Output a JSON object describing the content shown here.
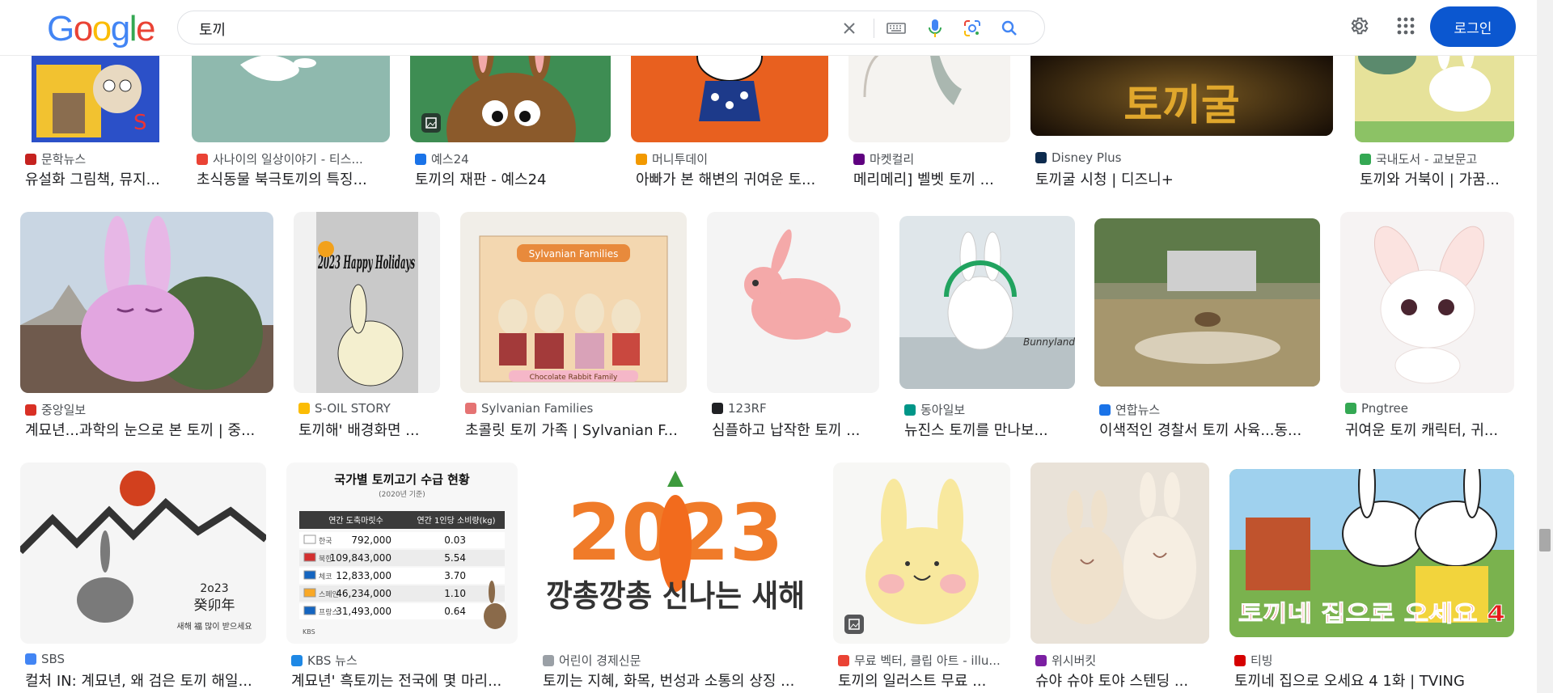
{
  "header": {
    "logo": [
      "G",
      "o",
      "o",
      "g",
      "l",
      "e"
    ],
    "logo_colors": [
      "#4285f4",
      "#ea4335",
      "#fbbc05",
      "#4285f4",
      "#34a853",
      "#ea4335"
    ],
    "query": "토끼",
    "signin": "로그인"
  },
  "results": [
    {
      "source": "문학뉴스",
      "title": "유설화 그림책, 뮤지...",
      "fav": "#c5221f"
    },
    {
      "source": "사나이의 일상이야기 - 티스...",
      "title": "초식동물 북극토끼의 특징...",
      "fav": "#ea4335"
    },
    {
      "source": "예스24",
      "title": "토끼의 재판 - 예스24",
      "fav": "#1a73e8"
    },
    {
      "source": "머니투데이",
      "title": "아빠가 본 해변의 귀여운 토...",
      "fav": "#f29900"
    },
    {
      "source": "마켓컬리",
      "title": "메리메리] 벨벳 토끼 ...",
      "fav": "#5f0080"
    },
    {
      "source": "Disney Plus",
      "title": "토끼굴 시청 | 디즈니+",
      "fav": "#0d2b4e"
    },
    {
      "source": "국내도서 - 교보문고",
      "title": "토끼와 거북이 | 가꿈...",
      "fav": "#34a853"
    },
    {
      "source": "중앙일보",
      "title": "계묘년...과학의 눈으로 본 토끼 | 중...",
      "fav": "#d93025"
    },
    {
      "source": "S-OIL STORY",
      "title": "토끼해' 배경화면 ...",
      "fav": "#fbbc05"
    },
    {
      "source": "Sylvanian Families",
      "title": "초콜릿 토끼 가족 | Sylvanian F...",
      "fav": "#e57373"
    },
    {
      "source": "123RF",
      "title": "심플하고 납작한 토끼 ...",
      "fav": "#202124"
    },
    {
      "source": "동아일보",
      "title": "뉴진스 토끼를 만나보...",
      "fav": "#009688"
    },
    {
      "source": "연합뉴스",
      "title": "이색적인 경찰서 토끼 사육...동...",
      "fav": "#1a73e8"
    },
    {
      "source": "Pngtree",
      "title": "귀여운 토끼 캐릭터, 귀...",
      "fav": "#34a853"
    },
    {
      "source": "SBS",
      "title": "컬처 IN: 계묘년, 왜 검은 토끼 해일...",
      "fav": "#4285f4"
    },
    {
      "source": "KBS 뉴스",
      "title": "계묘년' 흑토끼는 전국에 몇 마리...",
      "fav": "#1e88e5"
    },
    {
      "source": "어린이 경제신문",
      "title": "토끼는 지혜, 화목, 번성과 소통의 상징 ...",
      "fav": "#9aa0a6"
    },
    {
      "source": "무료 벡터, 클립 아트 - illu...",
      "title": "토끼의 일러스트 무료 ...",
      "fav": "#ea4335"
    },
    {
      "source": "위시버킷",
      "title": "슈야 슈야 토야 스텐딩 ...",
      "fav": "#7b1fa2"
    },
    {
      "source": "티빙",
      "title": "토끼네 집으로 오세요 4 1화 | TVING",
      "fav": "#d50000"
    }
  ],
  "images": {
    "disney_text": "토끼굴",
    "holiday_text": "2023 Happy Holidays",
    "sylvanian_brand": "Sylvanian Families",
    "sylvanian_box": "Chocolate Rabbit Family",
    "bunnyland": "Bunnyland",
    "sbs_year": "2o23",
    "sbs_cjk": "癸卯年",
    "sbs_small": "새해 福 많이 받으세요",
    "kbs_title": "국가별 토끼고기 수급 현황",
    "kbs_sub": "(2020년 기준)",
    "kbs_table_headers": [
      "연간 도축마릿수",
      "연간 1인당 소비량(kg)"
    ],
    "kbs_rows": [
      {
        "country": "한국",
        "n": "792,000",
        "kg": "0.03",
        "flag": "#ffffff"
      },
      {
        "country": "북한",
        "n": "109,843,000",
        "kg": "5.54",
        "flag": "#d32f2f"
      },
      {
        "country": "체코",
        "n": "12,833,000",
        "kg": "3.70",
        "flag": "#1565c0"
      },
      {
        "country": "스페인",
        "n": "46,234,000",
        "kg": "1.10",
        "flag": "#f9a825"
      },
      {
        "country": "프랑스",
        "n": "31,493,000",
        "kg": "0.64",
        "flag": "#1565c0"
      }
    ],
    "kbs_footer": "KBS",
    "ny_year": "2023",
    "ny_text": "깡총깡총 신나는 새해",
    "tving_text": "토끼네 집으로 오세요 4"
  }
}
